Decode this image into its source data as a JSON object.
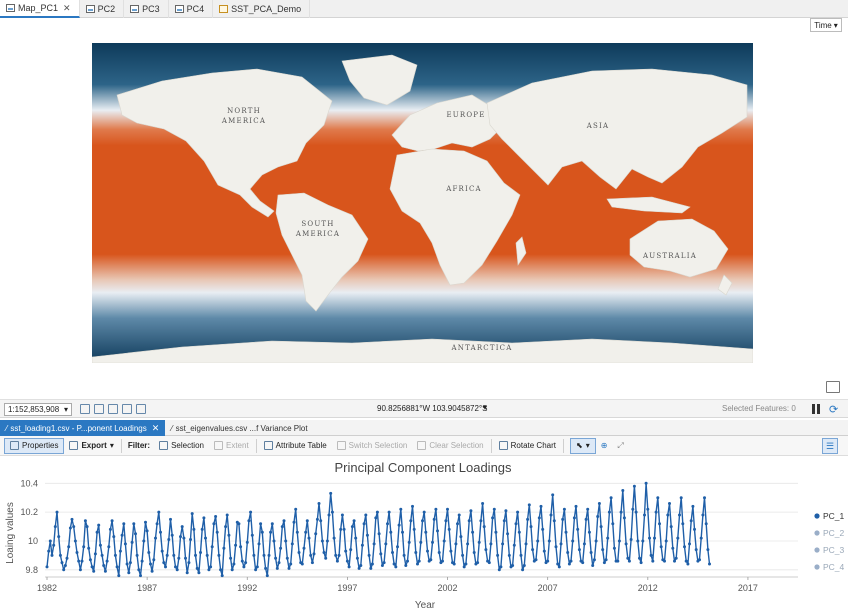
{
  "tabs": [
    {
      "label": "Map_PC1",
      "icon": "map-icon",
      "active": true,
      "closable": true
    },
    {
      "label": "PC2",
      "icon": "map-icon"
    },
    {
      "label": "PC3",
      "icon": "map-icon"
    },
    {
      "label": "PC4",
      "icon": "map-icon"
    },
    {
      "label": "SST_PCA_Demo",
      "icon": "layout-icon"
    }
  ],
  "time_button": "Time",
  "map": {
    "labels": {
      "north_america": [
        "NORTH",
        "AMERICA"
      ],
      "europe": "EUROPE",
      "asia": "ASIA",
      "africa": "AFRICA",
      "south_america": [
        "SOUTH",
        "AMERICA"
      ],
      "australia": "AUSTRALIA",
      "antarctica": "ANTARCTICA"
    },
    "colors": {
      "warm": "#d8551c",
      "cold": "#0e3a5a",
      "mid": "#e9eef3",
      "land": "#f1f0eb"
    }
  },
  "status": {
    "scale": "1:152,853,908",
    "coords": "90.8256881°W 103.9045872°S",
    "selected": "Selected Features: 0"
  },
  "chart_tabs": [
    {
      "label": "sst_loading1.csv - P...ponent Loadings",
      "active": true
    },
    {
      "label": "sst_eigenvalues.csv ...f Variance Plot"
    }
  ],
  "toolbar": {
    "properties": "Properties",
    "export": "Export",
    "filter": "Filter:",
    "selection": "Selection",
    "extent": "Extent",
    "attribute_table": "Attribute Table",
    "switch_selection": "Switch Selection",
    "clear_selection": "Clear Selection",
    "rotate_chart": "Rotate Chart"
  },
  "chart_data": {
    "type": "line",
    "title": "Principal Component Loadings",
    "xlabel": "Year",
    "ylabel": "Loaing values",
    "xticks": [
      "1982",
      "1987",
      "1992",
      "1997",
      "2002",
      "2007",
      "2012",
      "2017"
    ],
    "xtick_values": [
      1982,
      1987,
      1992,
      1997,
      2002,
      2007,
      2012,
      2017
    ],
    "yticks": [
      "9.8",
      "10",
      "10.2",
      "10.4"
    ],
    "ylim": [
      9.75,
      10.43
    ],
    "xlim": [
      1981.9,
      2019.5
    ],
    "legend_position": "right",
    "series": [
      {
        "name": "PC_1",
        "active": true,
        "color": "#1f5fa8"
      },
      {
        "name": "PC_2",
        "active": false,
        "color": "#9aaec8"
      },
      {
        "name": "PC_3",
        "active": false,
        "color": "#9aaec8"
      },
      {
        "name": "PC_4",
        "active": false,
        "color": "#9aaec8"
      }
    ],
    "start_year": 1982,
    "points_per_year": 12,
    "values": [
      9.82,
      9.93,
      10.0,
      9.9,
      9.97,
      10.1,
      10.2,
      10.03,
      9.9,
      9.85,
      9.8,
      9.83,
      9.88,
      9.96,
      10.09,
      10.15,
      10.1,
      10.0,
      9.92,
      9.86,
      9.8,
      9.86,
      9.96,
      10.14,
      10.1,
      9.95,
      9.87,
      9.82,
      9.79,
      9.91,
      10.06,
      10.11,
      9.97,
      9.9,
      9.83,
      9.79,
      9.86,
      9.96,
      10.08,
      10.14,
      10.03,
      9.9,
      9.82,
      9.76,
      9.93,
      10.04,
      10.12,
      9.98,
      9.84,
      9.78,
      9.85,
      9.99,
      10.12,
      10.05,
      9.9,
      9.8,
      9.76,
      9.86,
      10.0,
      10.13,
      10.07,
      9.92,
      9.84,
      9.79,
      9.87,
      10.02,
      10.12,
      10.2,
      10.06,
      9.93,
      9.85,
      9.82,
      9.9,
      10.01,
      10.15,
      10.04,
      9.9,
      9.82,
      9.8,
      9.88,
      10.03,
      10.1,
      10.02,
      9.88,
      9.78,
      9.85,
      10.01,
      10.19,
      10.08,
      9.9,
      9.81,
      9.78,
      9.92,
      10.08,
      10.16,
      10.02,
      9.9,
      9.8,
      9.82,
      9.96,
      10.12,
      10.17,
      10.06,
      9.9,
      9.8,
      9.76,
      9.95,
      10.1,
      10.18,
      10.04,
      9.88,
      9.8,
      9.84,
      9.97,
      10.13,
      10.12,
      9.96,
      9.86,
      9.82,
      9.85,
      9.99,
      10.14,
      10.2,
      10.04,
      9.9,
      9.8,
      9.82,
      9.98,
      10.12,
      10.06,
      9.9,
      9.81,
      9.76,
      9.9,
      10.06,
      10.12,
      10.0,
      9.88,
      9.81,
      9.85,
      9.95,
      10.1,
      10.14,
      10.0,
      9.88,
      9.81,
      9.84,
      9.98,
      10.13,
      10.22,
      10.06,
      9.92,
      9.85,
      9.84,
      9.95,
      10.06,
      10.14,
      10.02,
      9.9,
      9.85,
      9.91,
      10.05,
      10.15,
      10.26,
      10.14,
      10.0,
      9.92,
      9.88,
      10.0,
      10.18,
      10.33,
      10.2,
      10.02,
      9.9,
      9.86,
      9.9,
      10.08,
      10.18,
      10.08,
      9.93,
      9.86,
      9.82,
      9.94,
      10.1,
      10.14,
      10.02,
      9.88,
      9.81,
      9.83,
      9.97,
      10.12,
      10.18,
      10.04,
      9.9,
      9.81,
      9.84,
      9.98,
      10.16,
      10.2,
      10.05,
      9.91,
      9.83,
      9.85,
      9.98,
      10.12,
      10.2,
      10.06,
      9.92,
      9.84,
      9.82,
      9.96,
      10.11,
      10.22,
      10.06,
      9.9,
      9.83,
      9.86,
      9.99,
      10.14,
      10.24,
      10.08,
      9.92,
      9.84,
      9.86,
      9.99,
      10.14,
      10.2,
      10.06,
      9.93,
      9.86,
      9.87,
      9.99,
      10.15,
      10.22,
      10.07,
      9.92,
      9.85,
      9.86,
      10.0,
      10.14,
      10.22,
      10.08,
      9.93,
      9.85,
      9.84,
      9.98,
      10.12,
      10.18,
      10.03,
      9.9,
      9.82,
      9.84,
      9.98,
      10.14,
      10.21,
      10.06,
      9.92,
      9.84,
      9.85,
      9.99,
      10.14,
      10.26,
      10.1,
      9.94,
      9.86,
      9.85,
      9.98,
      10.16,
      10.22,
      10.06,
      9.9,
      9.8,
      9.82,
      9.98,
      10.14,
      10.21,
      10.05,
      9.9,
      9.82,
      9.83,
      9.97,
      10.12,
      10.2,
      10.06,
      9.9,
      9.8,
      9.83,
      9.98,
      10.15,
      10.25,
      10.1,
      9.94,
      9.86,
      9.87,
      10.0,
      10.16,
      10.24,
      10.08,
      9.93,
      9.85,
      9.86,
      10.0,
      10.18,
      10.32,
      10.14,
      9.96,
      9.84,
      9.82,
      9.98,
      10.15,
      10.22,
      10.06,
      9.92,
      9.84,
      9.86,
      10.0,
      10.16,
      10.24,
      10.08,
      9.94,
      9.86,
      9.85,
      9.98,
      10.15,
      10.22,
      10.06,
      9.92,
      9.83,
      9.87,
      10.0,
      10.17,
      10.26,
      10.1,
      9.94,
      9.85,
      9.87,
      10.02,
      10.2,
      10.3,
      10.12,
      9.95,
      9.86,
      9.86,
      10.0,
      10.2,
      10.35,
      10.16,
      9.98,
      9.88,
      9.86,
      10.01,
      10.22,
      10.38,
      10.2,
      10.0,
      9.88,
      9.85,
      10.0,
      10.18,
      10.4,
      10.22,
      10.02,
      9.9,
      9.86,
      10.02,
      10.2,
      10.3,
      10.12,
      9.96,
      9.87,
      9.86,
      10.0,
      10.18,
      10.26,
      10.1,
      9.95,
      9.86,
      9.88,
      10.02,
      10.18,
      10.3,
      10.12,
      9.96,
      9.86,
      9.84,
      9.98,
      10.14,
      10.24,
      10.08,
      9.94,
      9.86,
      9.87,
      10.02,
      10.18,
      10.3,
      10.12,
      9.94,
      9.84
    ]
  }
}
